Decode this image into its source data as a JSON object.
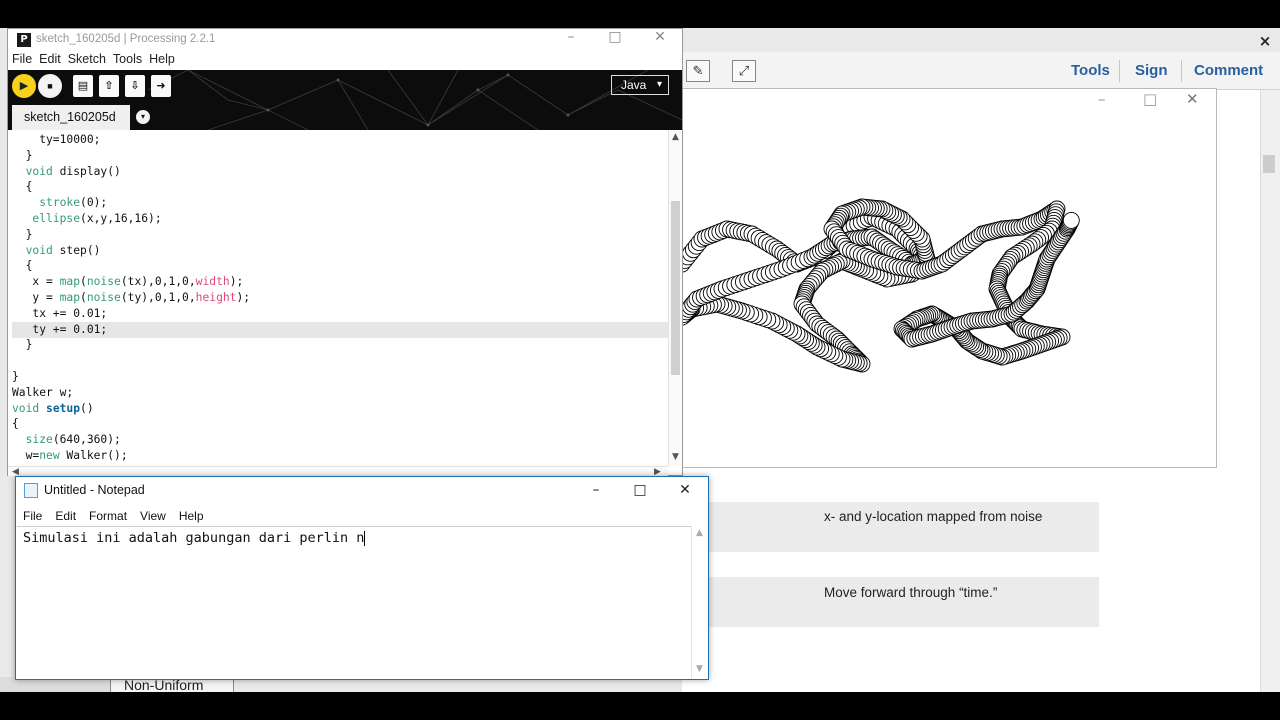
{
  "pdf_reader": {
    "close_glyph": "×",
    "toolbar_tabs": [
      "Tools",
      "Sign",
      "Comment"
    ],
    "tool_icons": [
      "highlighter-icon",
      "expand-icon"
    ],
    "caption_noise": "x- and y-location mapped from noise",
    "caption_time": "Move forward through “time.”",
    "sidebar_tab": "Non-Uniform"
  },
  "sketch_window": {
    "controls": [
      "–",
      "□",
      "✕"
    ]
  },
  "ide": {
    "title": "sketch_160205d | Processing 2.2.1",
    "logo_letter": "P",
    "controls": [
      "–",
      "□",
      "✕"
    ],
    "menu": [
      "File",
      "Edit",
      "Sketch",
      "Tools",
      "Help"
    ],
    "toolbar": {
      "run_icon": "▶",
      "stop_icon": "■",
      "buttons": [
        "new-icon",
        "open-icon",
        "save-icon",
        "export-icon"
      ],
      "mode_label": "Java",
      "mode_arrow": "▾"
    },
    "tab_name": "sketch_160205d",
    "tab_menu_glyph": "▾",
    "code_lines": [
      "    ty=10000;",
      "  }",
      "  void display()",
      "  {",
      "    stroke(0);",
      "   ellipse(x,y,16,16);",
      "  }",
      "  void step()",
      "  {",
      "   x = map(noise(tx),0,1,0,width);",
      "   y = map(noise(ty),0,1,0,height);",
      "   tx += 0.01;",
      "   ty += 0.01;",
      "  }",
      "",
      "}",
      "Walker w;",
      "void setup()",
      "{",
      "  size(640,360);",
      "  w=new Walker();"
    ],
    "highlighted_line": 12
  },
  "notepad": {
    "title": "Untitled - Notepad",
    "controls": [
      "–",
      "□",
      "✕"
    ],
    "menu": [
      "File",
      "Edit",
      "Format",
      "View",
      "Help"
    ],
    "text": "Simulasi ini adalah gabungan dari perlin n"
  }
}
